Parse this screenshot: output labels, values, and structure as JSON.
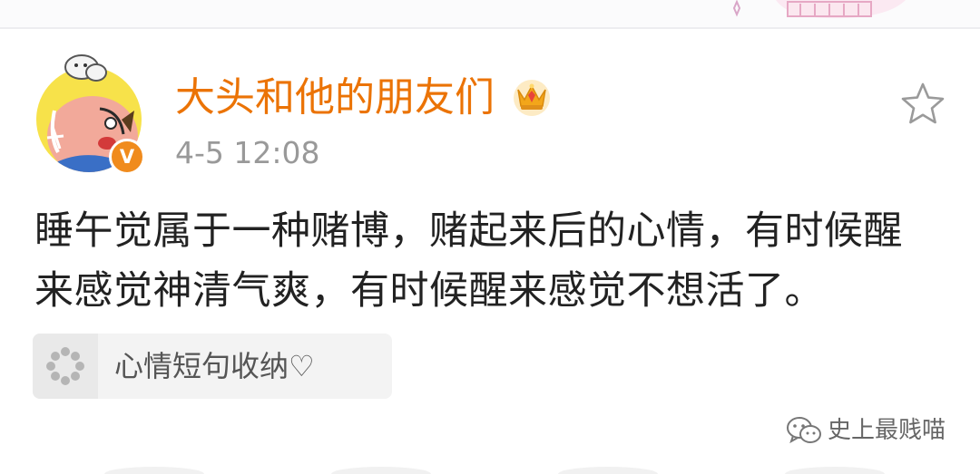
{
  "post": {
    "author_name": "大头和他的朋友们",
    "timestamp": "4-5 12:08",
    "vip_mark": "V",
    "text_lines": [
      "睡午觉属于一种赌博，赌起来后的心情，有时候醒",
      "来感觉神清气爽，有时候醒来感觉不想活了。"
    ],
    "topic": {
      "label": "心情短句收纳♡",
      "icon": "loading-dots-icon"
    }
  },
  "icons": {
    "favorite": "star-outline-icon",
    "member": "crown-icon",
    "watermark_source": "wechat-icon"
  },
  "watermark": {
    "text": "史上最贱喵"
  },
  "colors": {
    "author_name": "#eb7305",
    "timestamp": "#999999",
    "body_text": "#222222",
    "vip_badge": "#f08b1d",
    "chip_bg": "#f3f3f3"
  }
}
